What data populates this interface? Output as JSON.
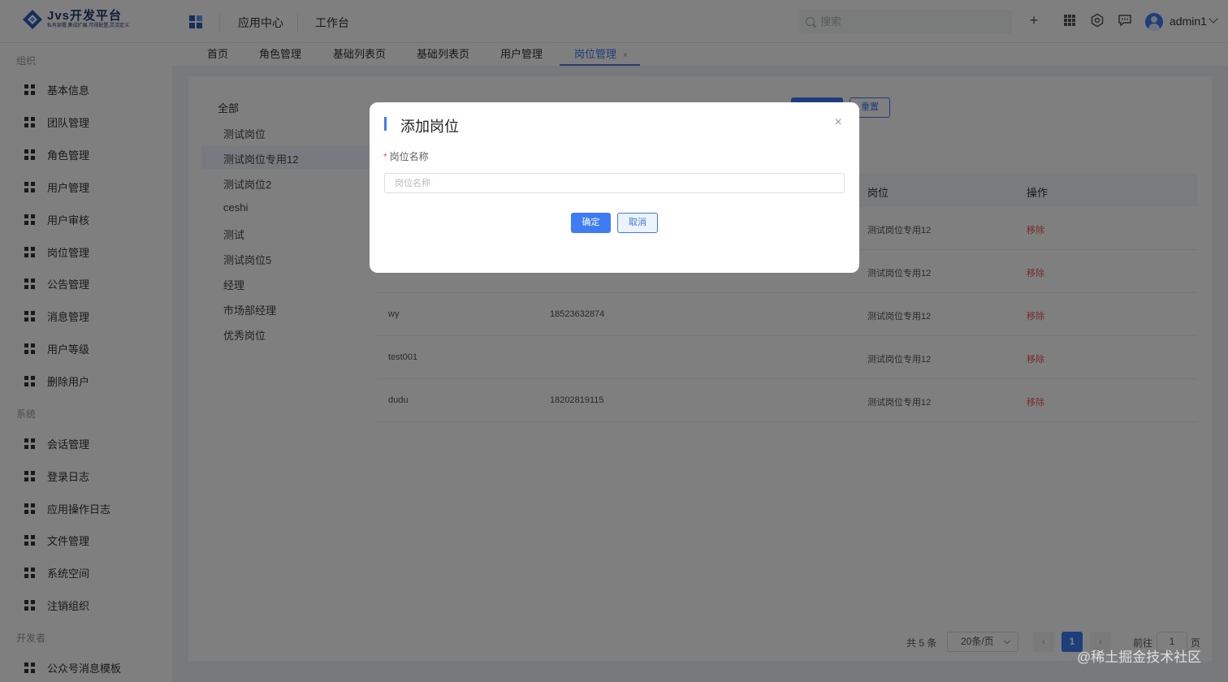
{
  "header": {
    "logo_title": "Jvs开发平台",
    "logo_subtitle": "私有部署,集成扩展,可视配置,灵活定义",
    "nav": [
      "应用中心",
      "工作台"
    ],
    "search_placeholder": "搜索",
    "username": "admin1"
  },
  "sidebar": {
    "groups": [
      {
        "label": "组织",
        "items": [
          "基本信息",
          "团队管理",
          "角色管理",
          "用户管理",
          "用户审核",
          "岗位管理",
          "公告管理",
          "消息管理",
          "用户等级",
          "删除用户"
        ]
      },
      {
        "label": "系统",
        "items": [
          "会话管理",
          "登录日志",
          "应用操作日志",
          "文件管理",
          "系统空间",
          "注销组织"
        ]
      },
      {
        "label": "开发者",
        "items": [
          "公众号消息模板"
        ]
      }
    ]
  },
  "tabs": [
    {
      "label": "首页"
    },
    {
      "label": "角色管理"
    },
    {
      "label": "基础列表页"
    },
    {
      "label": "基础列表页"
    },
    {
      "label": "用户管理"
    },
    {
      "label": "岗位管理",
      "active": true,
      "close": "×"
    }
  ],
  "tree": {
    "all": "全部",
    "nodes": [
      "测试岗位",
      "测试岗位专用12",
      "测试岗位2",
      "ceshi",
      "测试",
      "测试岗位5",
      "经理",
      "市场部经理",
      "优秀岗位"
    ]
  },
  "filters": {
    "reset_label": "重置"
  },
  "table": {
    "headers": {
      "post": "岗位",
      "op": "操作"
    },
    "rows": [
      {
        "name": "",
        "phone": "",
        "post": "测试岗位专用12",
        "op": "移除"
      },
      {
        "name": "",
        "phone": "",
        "post": "测试岗位专用12",
        "op": "移除"
      },
      {
        "name": "wy",
        "phone": "18523632874",
        "post": "测试岗位专用12",
        "op": "移除"
      },
      {
        "name": "test001",
        "phone": "",
        "post": "测试岗位专用12",
        "op": "移除"
      },
      {
        "name": "dudu",
        "phone": "18202819115",
        "post": "测试岗位专用12",
        "op": "移除"
      }
    ]
  },
  "pagination": {
    "total": "共 5 条",
    "page_size": "20条/页",
    "current": "1",
    "goto_label": "前往",
    "goto_value": "1",
    "page_suffix": "页"
  },
  "modal": {
    "title": "添加岗位",
    "field_label": "岗位名称",
    "required_mark": "*",
    "field_placeholder": "岗位名称",
    "field_value": "",
    "ok_label": "确定",
    "cancel_label": "取消",
    "close_glyph": "×"
  },
  "watermark": "@稀土掘金技术社区",
  "colors": {
    "primary": "#3d7cf2",
    "danger": "#e55555",
    "mask": "rgba(0,0,0,0.5)"
  }
}
